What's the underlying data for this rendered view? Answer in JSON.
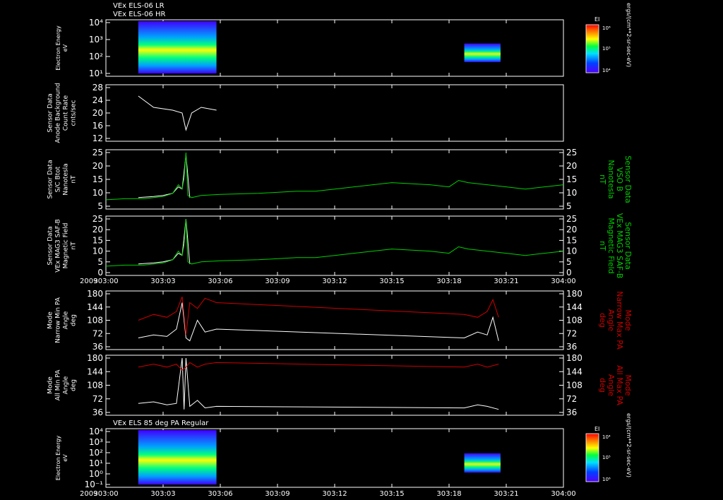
{
  "titles": {
    "lr": "VEx ELS-06 LR",
    "hr": "VEx ELS-06 HR",
    "pa": "VEx ELS 85 deg PA Regular"
  },
  "time_axis": {
    "year": "2009",
    "ticks": [
      "303:00",
      "303:03",
      "303:06",
      "303:09",
      "303:12",
      "303:15",
      "303:18",
      "303:21",
      "304:00"
    ]
  },
  "colorbar": {
    "label": "EI",
    "units": "ergs/(cm**2-sr-sec-eV)",
    "top_ticks": [
      "10⁶",
      "10⁵",
      "10⁴"
    ],
    "bottom_ticks": [
      "10⁴",
      "10⁵",
      "10⁶"
    ]
  },
  "chart_data": [
    {
      "id": "electron-energy-top",
      "type": "heatmap",
      "ylabel": [
        "Electron Energy",
        "eV"
      ],
      "yscale": "log",
      "ylim": [
        1,
        10000
      ],
      "yticks": [
        "10⁴",
        "10³",
        "10²",
        "10¹"
      ],
      "segments": [
        {
          "t0": 1.7,
          "t1": 5.8
        },
        {
          "t0": 18.8,
          "t1": 20.7
        }
      ]
    },
    {
      "id": "anode-background",
      "type": "line",
      "ylabel": [
        "Sensor Data",
        "Anode Background",
        "Count Rate",
        "cnts/sec"
      ],
      "ylim": [
        10,
        28
      ],
      "yticks": [
        "28",
        "24",
        "20",
        "16",
        "12"
      ],
      "series": [
        {
          "color": "#ffffff",
          "t": [
            1.7,
            2.5,
            3.5,
            4.0,
            4.2,
            4.5,
            5.0,
            5.8
          ],
          "v": [
            25,
            21,
            20,
            19,
            13,
            19,
            21,
            20
          ]
        }
      ]
    },
    {
      "id": "sc-bmag",
      "type": "line",
      "ylabel": [
        "Sensor Data",
        "S/C Btot",
        "Nanotesla",
        "nT"
      ],
      "right_label": [
        "Sensor Data",
        "VSO B",
        "Nanotesla",
        "nT"
      ],
      "ylim": [
        0,
        25
      ],
      "yticks": [
        "25",
        "20",
        "15",
        "10",
        "5"
      ],
      "series": [
        {
          "color": "#ffffff",
          "t": [
            1.7,
            2.5,
            3.0,
            3.5,
            3.8,
            4.0,
            4.2,
            4.4
          ],
          "v": [
            4,
            4.5,
            5,
            6,
            9,
            8,
            24,
            4
          ]
        },
        {
          "color": "#00d000",
          "t": [
            0,
            1,
            2,
            3,
            3.5,
            3.8,
            4.0,
            4.1,
            4.2,
            4.3,
            4.5,
            5,
            6,
            8,
            10,
            11,
            12,
            14,
            15,
            17,
            18,
            18.5,
            19,
            20,
            21,
            22,
            23,
            24
          ],
          "v": [
            3,
            3.5,
            3.5,
            4.5,
            6,
            10,
            8,
            13,
            25,
            5,
            4,
            5,
            5.5,
            6,
            7,
            7,
            8,
            10,
            11,
            10,
            9,
            12,
            11,
            10,
            9,
            8,
            9,
            10
          ]
        }
      ]
    },
    {
      "id": "mag-saf-b",
      "type": "line",
      "ylabel": [
        "Sensor Data",
        "VEx MAG3 SAF-B",
        "Magnetic Field",
        "nT"
      ],
      "right_label": [
        "Sensor Data",
        "VEx MAG3 SAF-B",
        "Magnetic Field",
        "nT"
      ],
      "ylim": [
        0,
        25
      ],
      "yticks": [
        "25",
        "20",
        "15",
        "10",
        "5",
        "0"
      ],
      "series": [
        {
          "color": "#ffffff",
          "t": [
            1.7,
            2.5,
            3.0,
            3.5,
            3.8,
            4.0,
            4.2,
            4.4
          ],
          "v": [
            4,
            4.5,
            5,
            6,
            9,
            8,
            25,
            4
          ]
        },
        {
          "color": "#00d000",
          "t": [
            0,
            1,
            2,
            3,
            3.5,
            3.8,
            4.0,
            4.1,
            4.2,
            4.3,
            4.5,
            5,
            6,
            8,
            10,
            11,
            12,
            14,
            15,
            17,
            18,
            18.5,
            19,
            20,
            21,
            22,
            23,
            24
          ],
          "v": [
            3,
            3.5,
            3.5,
            4.5,
            6,
            10,
            8,
            13,
            25,
            5,
            4,
            5,
            5.5,
            6,
            7,
            7,
            8,
            10,
            11,
            10,
            9,
            12,
            11,
            10,
            9,
            8,
            9,
            10
          ]
        }
      ]
    },
    {
      "id": "narrow-pa",
      "type": "line",
      "ylabel": [
        "Mode",
        "Narrow Min PA",
        "Angle",
        "deg"
      ],
      "right_label": [
        "Mode",
        "Narrow Max PA",
        "Angle",
        "deg"
      ],
      "ylim": [
        0,
        180
      ],
      "yticks": [
        "180",
        "144",
        "108",
        "72",
        "36"
      ],
      "series": [
        {
          "color": "#ffffff",
          "t": [
            1.7,
            2.5,
            3.2,
            3.7,
            4.0,
            4.2,
            4.4,
            4.8,
            5.2,
            5.8,
            18.8,
            19.5,
            20.0,
            20.3,
            20.6
          ],
          "v": [
            30,
            40,
            35,
            60,
            150,
            30,
            20,
            90,
            50,
            60,
            30,
            50,
            40,
            100,
            20
          ]
        },
        {
          "color": "#d00000",
          "t": [
            1.7,
            2.5,
            3.2,
            3.7,
            4.0,
            4.2,
            4.4,
            4.8,
            5.2,
            5.8,
            18.8,
            19.5,
            20.0,
            20.3,
            20.6
          ],
          "v": [
            90,
            110,
            100,
            120,
            170,
            40,
            150,
            130,
            165,
            150,
            110,
            100,
            120,
            160,
            100
          ]
        }
      ]
    },
    {
      "id": "all-pa",
      "type": "line",
      "ylabel": [
        "Mode",
        "All Min PA",
        "Angle",
        "deg"
      ],
      "right_label": [
        "Mode",
        "All Max PA",
        "Angle",
        "deg"
      ],
      "ylim": [
        0,
        180
      ],
      "yticks": [
        "180",
        "144",
        "108",
        "72",
        "36"
      ],
      "series": [
        {
          "color": "#ffffff",
          "t": [
            1.7,
            2.5,
            3.2,
            3.7,
            4.0,
            4.1,
            4.2,
            4.4,
            4.8,
            5.2,
            5.8,
            18.8,
            19.5,
            20.0,
            20.6
          ],
          "v": [
            30,
            35,
            25,
            30,
            180,
            10,
            180,
            20,
            40,
            15,
            20,
            15,
            25,
            20,
            10
          ]
        },
        {
          "color": "#d00000",
          "t": [
            1.7,
            2.5,
            3.2,
            3.7,
            4.0,
            4.2,
            4.4,
            4.8,
            5.2,
            5.8,
            18.8,
            19.5,
            20.0,
            20.6
          ],
          "v": [
            150,
            160,
            150,
            160,
            140,
            150,
            165,
            150,
            160,
            165,
            150,
            160,
            150,
            160
          ]
        }
      ]
    },
    {
      "id": "electron-energy-bottom",
      "type": "heatmap",
      "ylabel": [
        "Electron Energy",
        "eV"
      ],
      "yscale": "log",
      "ylim": [
        1,
        10000
      ],
      "yticks": [
        "10⁴",
        "10³",
        "10²",
        "10¹",
        "10⁰",
        "10⁻¹"
      ],
      "segments": [
        {
          "t0": 1.7,
          "t1": 5.8
        },
        {
          "t0": 18.8,
          "t1": 20.7
        }
      ]
    }
  ]
}
